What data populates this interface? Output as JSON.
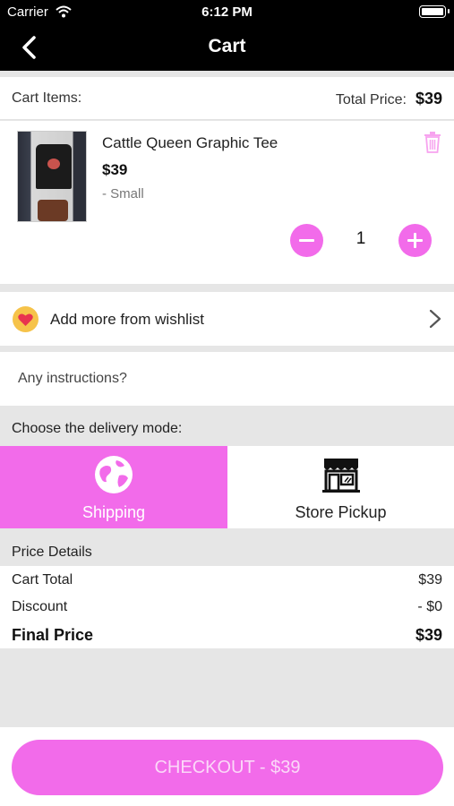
{
  "status_bar": {
    "carrier": "Carrier",
    "time": "6:12 PM"
  },
  "nav": {
    "title": "Cart",
    "back_icon": "chevron-left-icon"
  },
  "cart_header": {
    "items_label": "Cart Items:",
    "total_label": "Total Price:",
    "total_value": "$39"
  },
  "items": [
    {
      "name": "Cattle Queen Graphic Tee",
      "price": "$39",
      "variant": "- Small",
      "quantity": "1"
    }
  ],
  "wishlist": {
    "label": "Add more from wishlist",
    "icon": "heart-icon"
  },
  "instructions": {
    "placeholder": "Any instructions?",
    "value": ""
  },
  "delivery": {
    "title": "Choose the delivery mode:",
    "modes": [
      {
        "label": "Shipping",
        "icon": "globe-icon",
        "selected": true
      },
      {
        "label": "Store Pickup",
        "icon": "store-icon",
        "selected": false
      }
    ]
  },
  "price_details": {
    "title": "Price Details",
    "rows": [
      {
        "label": "Cart Total",
        "value": "$39"
      },
      {
        "label": "Discount",
        "value": "- $0"
      }
    ],
    "final_label": "Final Price",
    "final_value": "$39"
  },
  "checkout": {
    "label": "CHECKOUT - $39"
  },
  "colors": {
    "accent": "#f26bea",
    "nav_bg": "#000000",
    "badge": "#f6c34a"
  }
}
